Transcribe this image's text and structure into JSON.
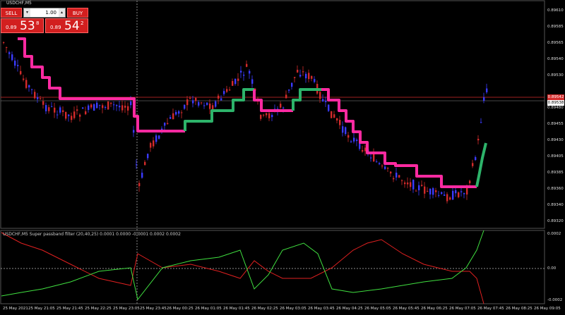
{
  "chart": {
    "title": "USDCHF,M5",
    "colors": {
      "bull": "#3b3bff",
      "bear": "#d42b2b",
      "step_up": "#2db36a",
      "step_down": "#ff2aa1",
      "ask_line": "#d42b2b"
    }
  },
  "trade_panel": {
    "sell_label": "SELL",
    "buy_label": "BUY",
    "lot_value": "1.00",
    "lot_down": "▾",
    "lot_up": "▴",
    "sell_price_prefix": "0.89",
    "sell_price_big": "53",
    "sell_price_sup": "8",
    "buy_price_prefix": "0.89",
    "buy_price_big": "54",
    "buy_price_sup": "2"
  },
  "price_axis": {
    "labels": [
      "0.89610",
      "0.89585",
      "0.89565",
      "0.89540",
      "0.89530",
      "0.89505",
      "0.89480",
      "0.89455",
      "0.89430",
      "0.89405",
      "0.89385",
      "0.89360",
      "0.89340",
      "0.89320",
      "0.89295",
      "0.89275"
    ],
    "current_price": "0.89538",
    "ask_price": "0.89542"
  },
  "indicator": {
    "title": "USDCHF,M5  Super passband filter (20,40,25) 0.0001 0.0000 -0.0001 0.0002 0.0002",
    "axis_labels": [
      "0.0002",
      "0.00",
      "-0.0002"
    ],
    "colors": {
      "line1": "#40e040",
      "line2": "#e02020",
      "zero": "#bbbbbb"
    }
  },
  "time_axis": {
    "labels": [
      "25 May 2021",
      "25 May 21:05",
      "25 May 21:45",
      "25 May 22:25",
      "25 May 23:05",
      "25 May 23:45",
      "26 May 00:25",
      "26 May 01:05",
      "26 May 01:45",
      "26 May 02:25",
      "26 May 03:05",
      "26 May 03:45",
      "26 May 04:25",
      "26 May 05:05",
      "26 May 05:45",
      "26 May 06:25",
      "26 May 07:05",
      "26 May 07:45",
      "26 May 08:25",
      "26 May 09:05"
    ]
  }
}
